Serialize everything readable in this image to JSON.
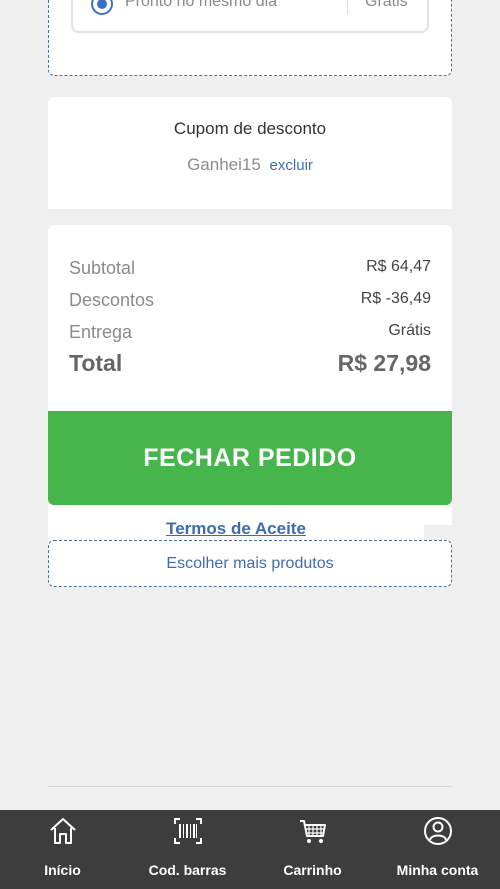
{
  "delivery": {
    "option_label": "Pronto no mesmo dia",
    "option_price": "Grátis"
  },
  "coupon": {
    "title": "Cupom de desconto",
    "code": "Ganhei15",
    "remove_label": "excluir"
  },
  "summary": {
    "subtotal_label": "Subtotal",
    "subtotal_value": "R$ 64,47",
    "discounts_label": "Descontos",
    "discounts_value": "R$ -36,49",
    "delivery_label": "Entrega",
    "delivery_value": "Grátis",
    "total_label": "Total",
    "total_value": "R$ 27,98"
  },
  "actions": {
    "checkout_label": "FECHAR PEDIDO",
    "terms_label": "Termos de Aceite",
    "more_products_label": "Escolher mais produtos"
  },
  "nav": {
    "items": [
      {
        "label": "Início",
        "icon": "home-icon"
      },
      {
        "label": "Cod. barras",
        "icon": "barcode-icon"
      },
      {
        "label": "Carrinho",
        "icon": "cart-icon"
      },
      {
        "label": "Minha conta",
        "icon": "account-icon"
      }
    ]
  },
  "colors": {
    "accent_green": "#45b54c",
    "link_blue": "#3f6db0",
    "nav_bg": "#3d3d3d"
  }
}
